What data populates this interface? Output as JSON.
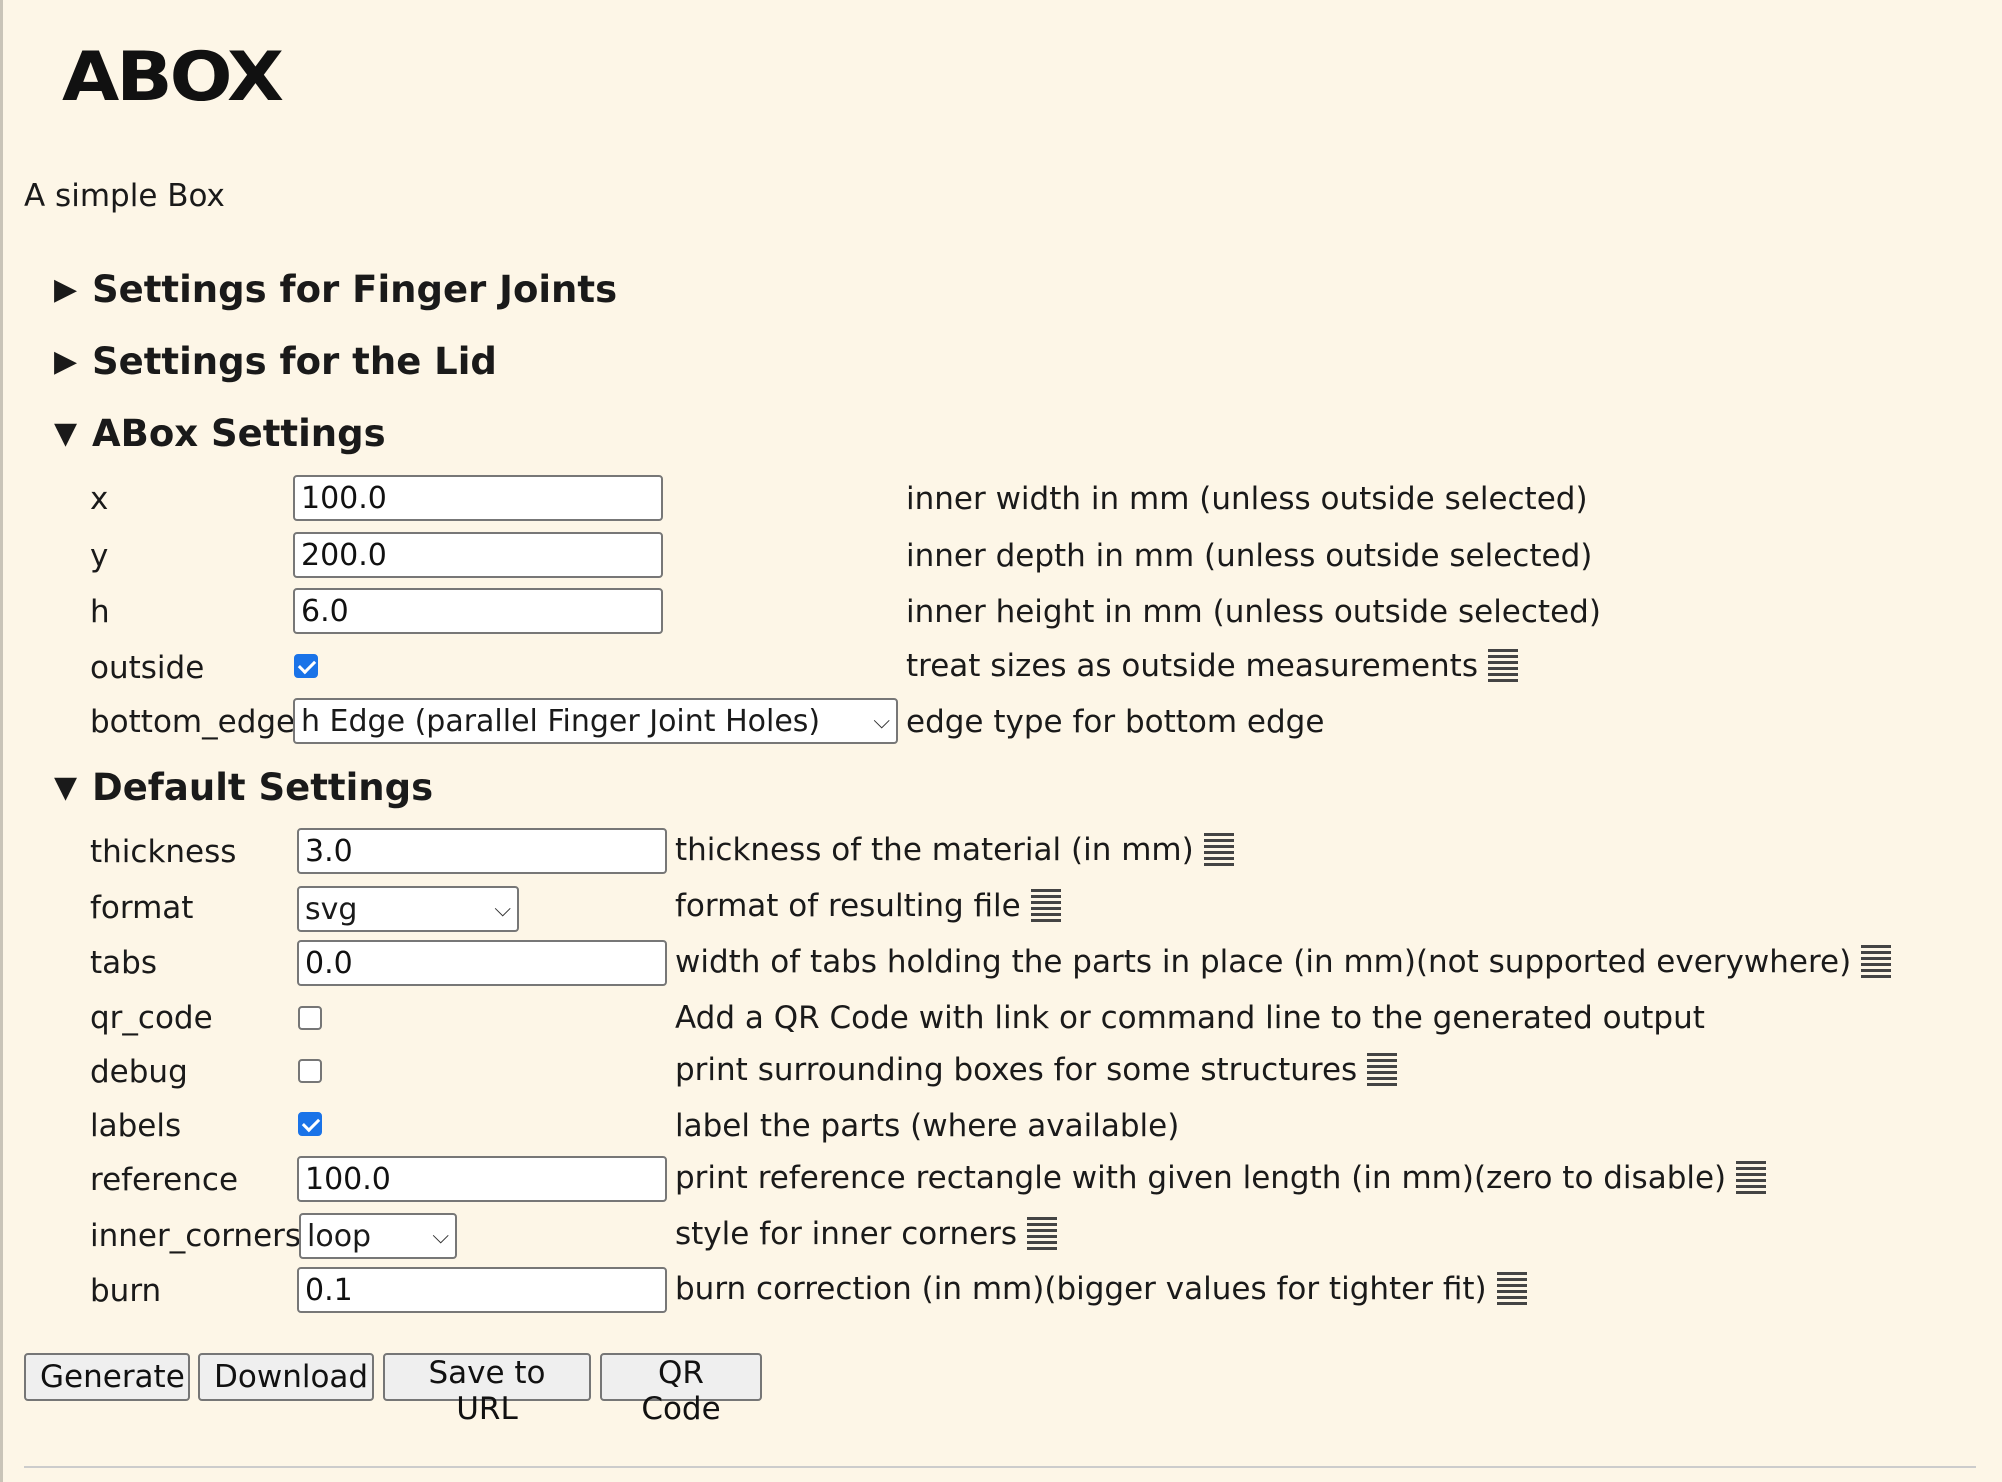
{
  "app": {
    "logo": "ABOX",
    "subtitle": "A simple Box"
  },
  "sections": {
    "finger_joints": {
      "title": "Settings for Finger Joints",
      "expanded": false
    },
    "lid": {
      "title": "Settings for the Lid",
      "expanded": false
    },
    "abox": {
      "title": "ABox Settings",
      "expanded": true
    },
    "defaults": {
      "title": "Default Settings",
      "expanded": true
    }
  },
  "toggle_icons": {
    "collapsed": "▶",
    "expanded": "▼"
  },
  "abox": {
    "x": {
      "label": "x",
      "value": "100.0",
      "desc": "inner width in mm (unless outside selected)"
    },
    "y": {
      "label": "y",
      "value": "200.0",
      "desc": "inner depth in mm (unless outside selected)"
    },
    "h": {
      "label": "h",
      "value": "6.0",
      "desc": "inner height in mm (unless outside selected)"
    },
    "outside": {
      "label": "outside",
      "checked": true,
      "desc": "treat sizes as outside measurements"
    },
    "bottom_edge": {
      "label": "bottom_edge",
      "value": "h Edge (parallel Finger Joint Holes)",
      "desc": "edge type for bottom edge"
    }
  },
  "defaults": {
    "thickness": {
      "label": "thickness",
      "value": "3.0",
      "desc": "thickness of the material (in mm)"
    },
    "format": {
      "label": "format",
      "value": "svg",
      "desc": "format of resulting file"
    },
    "tabs": {
      "label": "tabs",
      "value": "0.0",
      "desc": "width of tabs holding the parts in place (in mm)(not supported everywhere)"
    },
    "qr_code": {
      "label": "qr_code",
      "checked": false,
      "desc": "Add a QR Code with link or command line to the generated output"
    },
    "debug": {
      "label": "debug",
      "checked": false,
      "desc": "print surrounding boxes for some structures"
    },
    "labels": {
      "label": "labels",
      "checked": true,
      "desc": "label the parts (where available)"
    },
    "reference": {
      "label": "reference",
      "value": "100.0",
      "desc": "print reference rectangle with given length (in mm)(zero to disable)"
    },
    "inner_corners": {
      "label": "inner_corners",
      "value": "loop",
      "desc": "style for inner corners"
    },
    "burn": {
      "label": "burn",
      "value": "0.1",
      "desc": "burn correction (in mm)(bigger values for tighter fit)"
    }
  },
  "buttons": {
    "generate": "Generate",
    "download": "Download",
    "save_url": "Save to URL",
    "qr": "QR Code"
  },
  "icons": {
    "help": "help-lines-icon",
    "dropdown": "chevron-down-icon"
  },
  "colors": {
    "background": "#fdf6e7",
    "checkbox": "#1a73e8"
  }
}
